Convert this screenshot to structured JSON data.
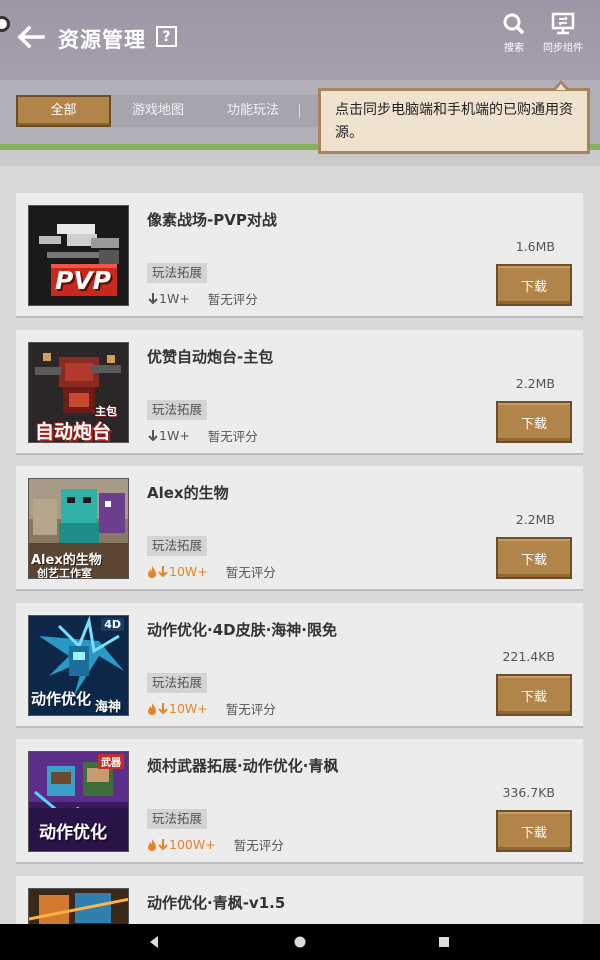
{
  "header": {
    "title": "资源管理",
    "help": "?",
    "search_label": "搜索",
    "sync_label": "同步组件"
  },
  "tabs": [
    {
      "label": "全部",
      "active": true
    },
    {
      "label": "游戏地图",
      "active": false
    },
    {
      "label": "功能玩法",
      "active": false
    }
  ],
  "tooltip": {
    "text": "点击同步电脑端和手机端的已购通用资源。"
  },
  "items": [
    {
      "title": "像素战场-PVP对战",
      "tag": "玩法拓展",
      "downloads": "1W+",
      "hot": false,
      "rating": "暂无评分",
      "size": "1.6MB",
      "button": "下载",
      "thumb": "pvp",
      "thumb_text": "PVP"
    },
    {
      "title": "优赞自动炮台-主包",
      "tag": "玩法拓展",
      "downloads": "1W+",
      "hot": false,
      "rating": "暂无评分",
      "size": "2.2MB",
      "button": "下载",
      "thumb": "turret",
      "thumb_text": "自动炮台",
      "thumb_sub": "主包"
    },
    {
      "title": "Alex的生物",
      "tag": "玩法拓展",
      "downloads": "10W+",
      "hot": true,
      "rating": "暂无评分",
      "size": "2.2MB",
      "button": "下载",
      "thumb": "alex",
      "thumb_text": "Alex的生物",
      "thumb_sub": "创艺工作室"
    },
    {
      "title": "动作优化·4D皮肤·海神·限免",
      "tag": "玩法拓展",
      "downloads": "10W+",
      "hot": true,
      "rating": "暂无评分",
      "size": "221.4KB",
      "button": "下载",
      "thumb": "poseidon",
      "thumb_text": "动作优化",
      "thumb_sub": "海神",
      "thumb_badge": "4D"
    },
    {
      "title": "烦村武器拓展·动作优化·青枫",
      "tag": "玩法拓展",
      "downloads": "100W+",
      "hot": true,
      "rating": "暂无评分",
      "size": "336.7KB",
      "button": "下载",
      "thumb": "weapons",
      "thumb_text": "动作优化",
      "thumb_badge": "武器"
    },
    {
      "title": "动作优化·青枫-v1.5",
      "tag": "",
      "downloads": "",
      "hot": false,
      "rating": "",
      "size": "",
      "button": "",
      "thumb": "qingfeng"
    }
  ],
  "colors": {
    "accent": "#b18449",
    "accent_border": "#6d4e28",
    "hot": "#e5852a",
    "header_bg": "#a19aaa",
    "card_bg": "#ececec",
    "green": "#86b25b"
  }
}
